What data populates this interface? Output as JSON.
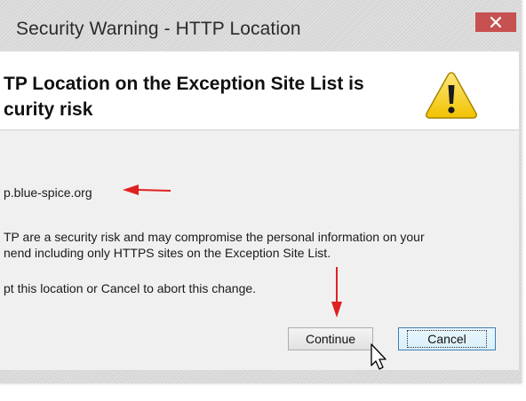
{
  "window": {
    "title": "Security Warning - HTTP Location",
    "close_glyph": "×"
  },
  "header": {
    "line1": "TP Location on the Exception Site List is",
    "line2": "curity risk",
    "icon": "warning-triangle-icon"
  },
  "body": {
    "location": "p.blue-spice.org",
    "risk_line1": "TP are a security risk and may compromise the personal information on your",
    "risk_line2": "nend including only HTTPS sites on the Exception Site List.",
    "instruction": "pt this location or Cancel to abort this change."
  },
  "buttons": {
    "continue_label": "Continue",
    "cancel_label": "Cancel"
  },
  "colors": {
    "close_button": "#c75050",
    "annotation_arrow": "#e02020",
    "warning_fill": "#f7d51d"
  }
}
